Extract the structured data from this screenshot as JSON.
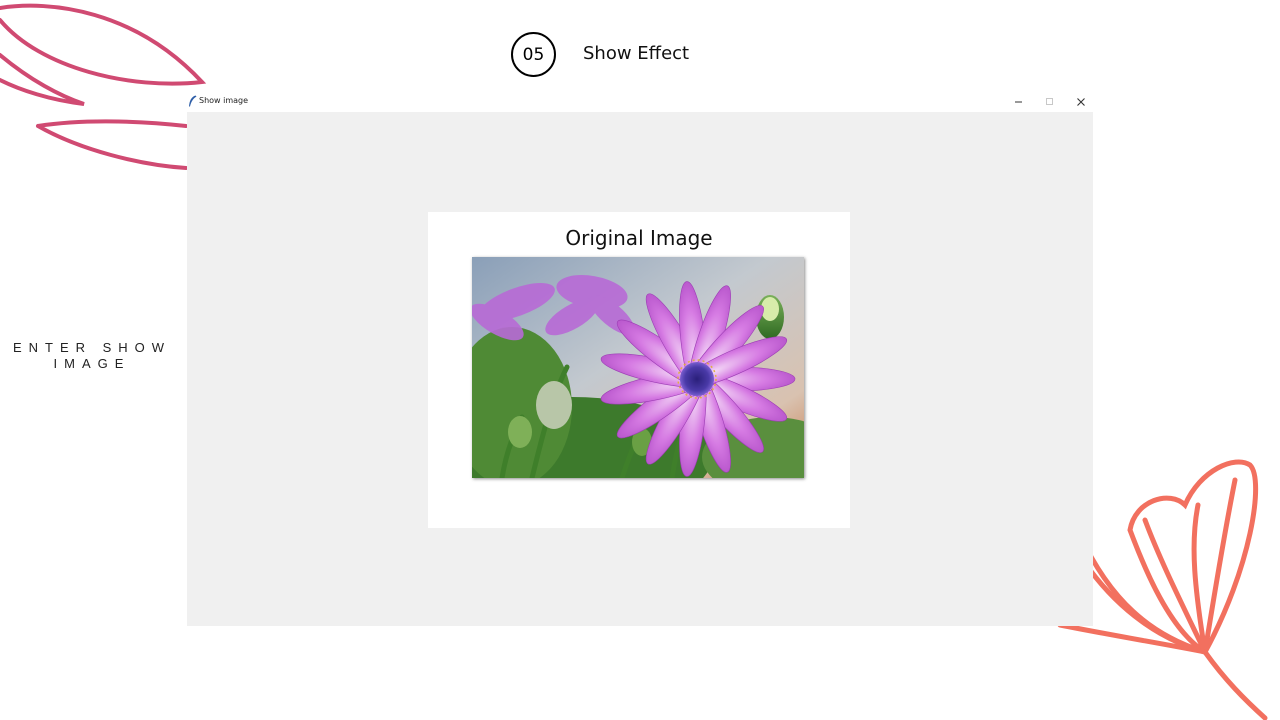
{
  "slide": {
    "step_number": "05",
    "step_title": "Show Effect",
    "side_caption": "ENTER SHOW IMAGE"
  },
  "window": {
    "title": "Show image",
    "app_icon": "feather-icon",
    "controls": [
      "minimize-icon",
      "maximize-icon",
      "close-icon"
    ]
  },
  "figure": {
    "title": "Original Image",
    "image_subject": "purple daisy flower photo"
  },
  "colors": {
    "left_decoration": "#d04a72",
    "right_decoration": "#f2705f",
    "client_background": "#f0f0f0",
    "flower_petal": "#c66ad8",
    "flower_center": "#3a2a8a"
  }
}
